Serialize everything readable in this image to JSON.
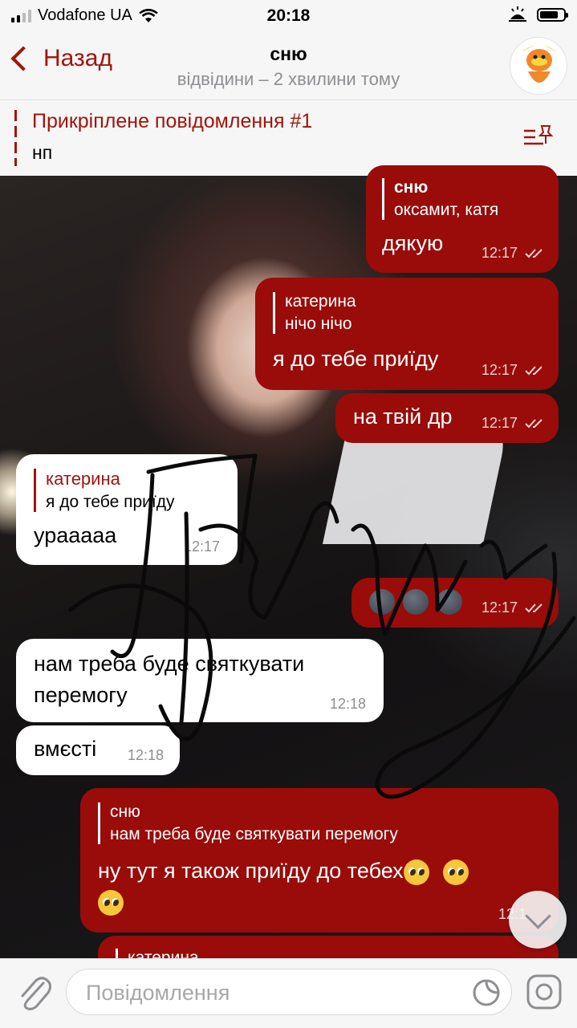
{
  "status_bar": {
    "carrier": "Vodafone UA",
    "time": "20:18"
  },
  "header": {
    "back_label": "Назад",
    "title": "сню",
    "subtitle": "відвідини – 2 хвилини тому"
  },
  "pinned": {
    "title": "Прикріплене повідомлення #1",
    "text": "нп"
  },
  "messages": [
    {
      "reply_name": "сню",
      "reply_text": "оксамит, катя",
      "text": "дякую",
      "time": "12:17"
    },
    {
      "reply_name": "катерина",
      "reply_text": "нічо нічо",
      "text": "я до тебе приїду",
      "time": "12:17"
    },
    {
      "text": "на твій др",
      "time": "12:17"
    },
    {
      "reply_name": "катерина",
      "reply_text": "я до тебе приїду",
      "text": "ураааaa",
      "time": "12:17"
    },
    {
      "text": "",
      "time": "12:17",
      "emoji": "new-moon-face x3"
    },
    {
      "text": "нам треба буде святкувати перемогу",
      "line1": "нам треба буде святкувати",
      "line2": "перемогу",
      "time": "12:18"
    },
    {
      "text": "вмєсті",
      "time": "12:18"
    },
    {
      "reply_name": "сню",
      "reply_text": "нам треба буде святкувати перемогу",
      "text": "ну тут я також приїду до тебех",
      "time": "12:1"
    },
    {
      "reply_name": "катерина"
    }
  ],
  "input": {
    "placeholder": "Повідомлення"
  },
  "colors": {
    "accent": "#a0150c",
    "outgoing_bubble": "#990c09",
    "incoming_bubble": "#ffffff",
    "bar_background": "#f6f6f6"
  },
  "icons": [
    "signal-icon",
    "wifi-icon",
    "alarm-icon",
    "battery-icon",
    "back-chevron-icon",
    "pin-list-icon",
    "attach-icon",
    "sticker-icon",
    "camera-icon",
    "scroll-down-icon"
  ]
}
